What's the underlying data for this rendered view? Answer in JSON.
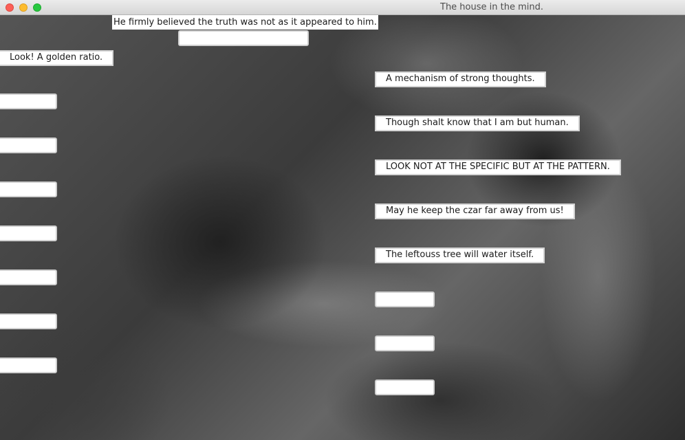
{
  "window": {
    "title": "The house in the mind."
  },
  "labels": {
    "header_quote": "He firmly believed the truth was not as it appeared to him.",
    "golden_ratio": "Look! A golden ratio.",
    "right": [
      "A mechanism of strong thoughts.",
      "Though shalt know that I am but human.",
      "LOOK NOT AT THE SPECIFIC BUT AT THE PATTERN.",
      "May he keep the czar far away from us!",
      "The leftouss tree will water itself."
    ]
  },
  "fields": {
    "top_field": {
      "value": "",
      "placeholder": ""
    },
    "left": [
      {
        "value": ""
      },
      {
        "value": ""
      },
      {
        "value": ""
      },
      {
        "value": ""
      },
      {
        "value": ""
      },
      {
        "value": ""
      },
      {
        "value": ""
      }
    ],
    "right": [
      {
        "value": ""
      },
      {
        "value": ""
      },
      {
        "value": ""
      }
    ]
  },
  "colors": {
    "close": "#fc5f57",
    "minimize": "#fdbc2e",
    "maximize": "#28c840"
  }
}
